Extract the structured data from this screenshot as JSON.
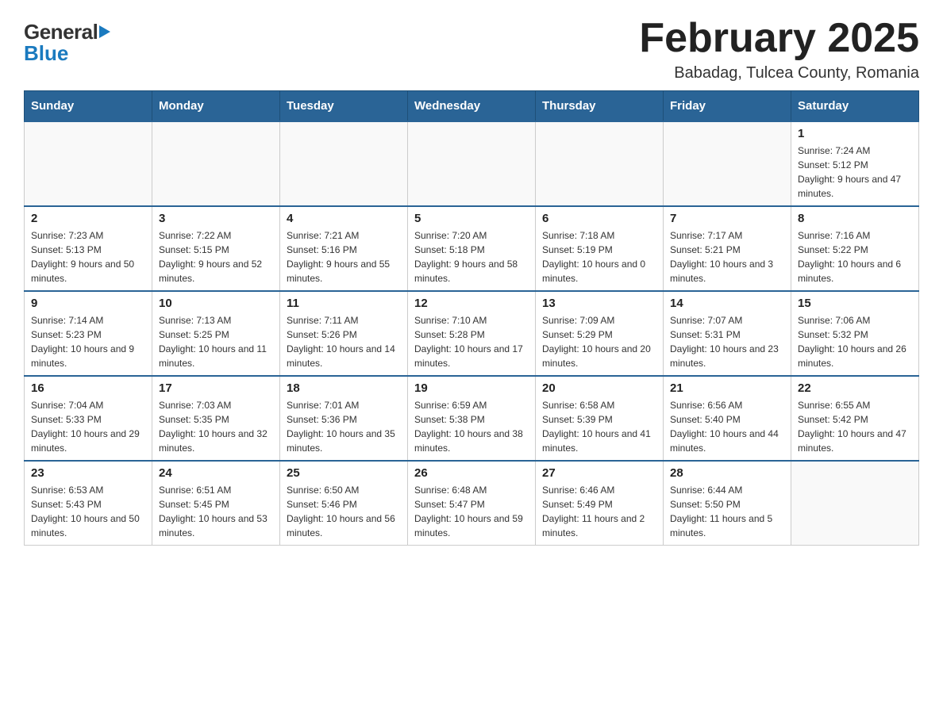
{
  "header": {
    "logo_general": "General",
    "logo_blue": "Blue",
    "title": "February 2025",
    "subtitle": "Babadag, Tulcea County, Romania"
  },
  "weekdays": [
    "Sunday",
    "Monday",
    "Tuesday",
    "Wednesday",
    "Thursday",
    "Friday",
    "Saturday"
  ],
  "weeks": [
    [
      {
        "day": "",
        "info": ""
      },
      {
        "day": "",
        "info": ""
      },
      {
        "day": "",
        "info": ""
      },
      {
        "day": "",
        "info": ""
      },
      {
        "day": "",
        "info": ""
      },
      {
        "day": "",
        "info": ""
      },
      {
        "day": "1",
        "info": "Sunrise: 7:24 AM\nSunset: 5:12 PM\nDaylight: 9 hours and 47 minutes."
      }
    ],
    [
      {
        "day": "2",
        "info": "Sunrise: 7:23 AM\nSunset: 5:13 PM\nDaylight: 9 hours and 50 minutes."
      },
      {
        "day": "3",
        "info": "Sunrise: 7:22 AM\nSunset: 5:15 PM\nDaylight: 9 hours and 52 minutes."
      },
      {
        "day": "4",
        "info": "Sunrise: 7:21 AM\nSunset: 5:16 PM\nDaylight: 9 hours and 55 minutes."
      },
      {
        "day": "5",
        "info": "Sunrise: 7:20 AM\nSunset: 5:18 PM\nDaylight: 9 hours and 58 minutes."
      },
      {
        "day": "6",
        "info": "Sunrise: 7:18 AM\nSunset: 5:19 PM\nDaylight: 10 hours and 0 minutes."
      },
      {
        "day": "7",
        "info": "Sunrise: 7:17 AM\nSunset: 5:21 PM\nDaylight: 10 hours and 3 minutes."
      },
      {
        "day": "8",
        "info": "Sunrise: 7:16 AM\nSunset: 5:22 PM\nDaylight: 10 hours and 6 minutes."
      }
    ],
    [
      {
        "day": "9",
        "info": "Sunrise: 7:14 AM\nSunset: 5:23 PM\nDaylight: 10 hours and 9 minutes."
      },
      {
        "day": "10",
        "info": "Sunrise: 7:13 AM\nSunset: 5:25 PM\nDaylight: 10 hours and 11 minutes."
      },
      {
        "day": "11",
        "info": "Sunrise: 7:11 AM\nSunset: 5:26 PM\nDaylight: 10 hours and 14 minutes."
      },
      {
        "day": "12",
        "info": "Sunrise: 7:10 AM\nSunset: 5:28 PM\nDaylight: 10 hours and 17 minutes."
      },
      {
        "day": "13",
        "info": "Sunrise: 7:09 AM\nSunset: 5:29 PM\nDaylight: 10 hours and 20 minutes."
      },
      {
        "day": "14",
        "info": "Sunrise: 7:07 AM\nSunset: 5:31 PM\nDaylight: 10 hours and 23 minutes."
      },
      {
        "day": "15",
        "info": "Sunrise: 7:06 AM\nSunset: 5:32 PM\nDaylight: 10 hours and 26 minutes."
      }
    ],
    [
      {
        "day": "16",
        "info": "Sunrise: 7:04 AM\nSunset: 5:33 PM\nDaylight: 10 hours and 29 minutes."
      },
      {
        "day": "17",
        "info": "Sunrise: 7:03 AM\nSunset: 5:35 PM\nDaylight: 10 hours and 32 minutes."
      },
      {
        "day": "18",
        "info": "Sunrise: 7:01 AM\nSunset: 5:36 PM\nDaylight: 10 hours and 35 minutes."
      },
      {
        "day": "19",
        "info": "Sunrise: 6:59 AM\nSunset: 5:38 PM\nDaylight: 10 hours and 38 minutes."
      },
      {
        "day": "20",
        "info": "Sunrise: 6:58 AM\nSunset: 5:39 PM\nDaylight: 10 hours and 41 minutes."
      },
      {
        "day": "21",
        "info": "Sunrise: 6:56 AM\nSunset: 5:40 PM\nDaylight: 10 hours and 44 minutes."
      },
      {
        "day": "22",
        "info": "Sunrise: 6:55 AM\nSunset: 5:42 PM\nDaylight: 10 hours and 47 minutes."
      }
    ],
    [
      {
        "day": "23",
        "info": "Sunrise: 6:53 AM\nSunset: 5:43 PM\nDaylight: 10 hours and 50 minutes."
      },
      {
        "day": "24",
        "info": "Sunrise: 6:51 AM\nSunset: 5:45 PM\nDaylight: 10 hours and 53 minutes."
      },
      {
        "day": "25",
        "info": "Sunrise: 6:50 AM\nSunset: 5:46 PM\nDaylight: 10 hours and 56 minutes."
      },
      {
        "day": "26",
        "info": "Sunrise: 6:48 AM\nSunset: 5:47 PM\nDaylight: 10 hours and 59 minutes."
      },
      {
        "day": "27",
        "info": "Sunrise: 6:46 AM\nSunset: 5:49 PM\nDaylight: 11 hours and 2 minutes."
      },
      {
        "day": "28",
        "info": "Sunrise: 6:44 AM\nSunset: 5:50 PM\nDaylight: 11 hours and 5 minutes."
      },
      {
        "day": "",
        "info": ""
      }
    ]
  ]
}
